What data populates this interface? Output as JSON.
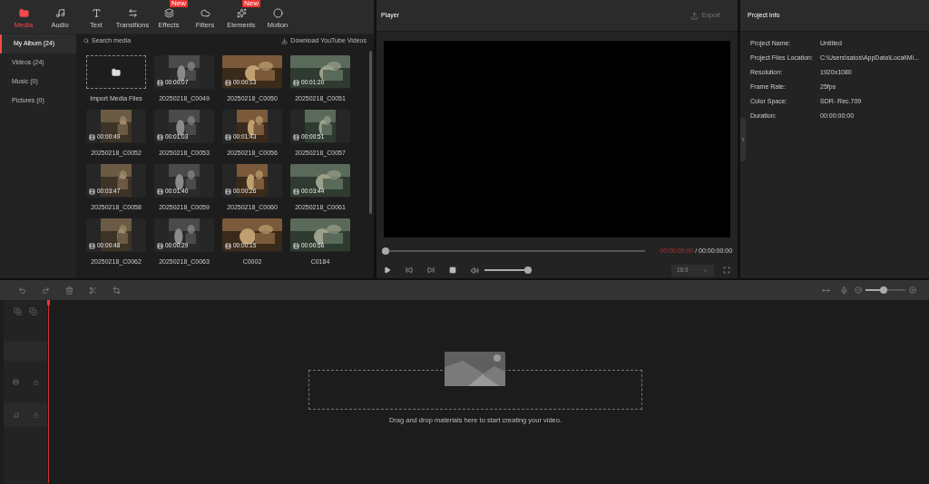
{
  "tabs": [
    {
      "label": "Media",
      "selected": true
    },
    {
      "label": "Audio",
      "selected": false
    },
    {
      "label": "Text",
      "selected": false
    },
    {
      "label": "Transitions",
      "selected": false
    },
    {
      "label": "Effects",
      "selected": false,
      "badge": "New"
    },
    {
      "label": "Filters",
      "selected": false
    },
    {
      "label": "Elements",
      "selected": false,
      "badge": "New"
    },
    {
      "label": "Motion",
      "selected": false
    }
  ],
  "sidebar": {
    "items": [
      {
        "label": "My Album (24)",
        "selected": true
      },
      {
        "label": "Videos (24)",
        "selected": false
      },
      {
        "label": "Music (0)",
        "selected": false
      },
      {
        "label": "Pictures (0)",
        "selected": false
      }
    ]
  },
  "search": {
    "placeholder": "Search media"
  },
  "download_link": "Download YouTube Videos",
  "media": [
    {
      "kind": "import",
      "name": "Import Media Files"
    },
    {
      "kind": "portrait",
      "name": "20250218_C0049",
      "duration": "00:00:07"
    },
    {
      "kind": "landscape",
      "name": "20250218_C0050",
      "duration": "00:00:13"
    },
    {
      "kind": "landscape",
      "name": "20250218_C0051",
      "duration": "00:01:20"
    },
    {
      "kind": "portrait",
      "name": "20250218_C0052",
      "duration": "00:00:49"
    },
    {
      "kind": "portrait",
      "name": "20250218_C0053",
      "duration": "00:01:03"
    },
    {
      "kind": "portrait",
      "name": "20250218_C0056",
      "duration": "00:01:43"
    },
    {
      "kind": "portrait",
      "name": "20250218_C0057",
      "duration": "00:00:51"
    },
    {
      "kind": "portrait",
      "name": "20250218_C0058",
      "duration": "00:03:47"
    },
    {
      "kind": "portrait",
      "name": "20250218_C0059",
      "duration": "00:01:40"
    },
    {
      "kind": "portrait",
      "name": "20250218_C0060",
      "duration": "00:00:26"
    },
    {
      "kind": "landscape",
      "name": "20250218_C0061",
      "duration": "00:03:44"
    },
    {
      "kind": "portrait",
      "name": "20250218_C0062",
      "duration": "00:00:48"
    },
    {
      "kind": "portrait",
      "name": "20250218_C0063",
      "duration": "00:00:29"
    },
    {
      "kind": "landscape",
      "name": "C0002",
      "duration": "00:00:15"
    },
    {
      "kind": "landscape",
      "name": "C0184",
      "duration": "00:00:56"
    }
  ],
  "player": {
    "title": "Player",
    "export": "Export",
    "current_time": "00:00:00:00",
    "total_time": "/ 00:00:00:00",
    "progress": {
      "level": 0
    },
    "volume": {
      "level": 1
    },
    "aspect": "16:9"
  },
  "project_info": {
    "title": "Project Info",
    "rows": [
      {
        "label": "Project Name:",
        "value": "Untitled"
      },
      {
        "label": "Project Files Location:",
        "value": "C:\\Users\\satos\\AppData\\Local\\Mi..."
      },
      {
        "label": "Resolution:",
        "value": "1920x1080"
      },
      {
        "label": "Frame Rate:",
        "value": "25fps"
      },
      {
        "label": "Color Space:",
        "value": "SDR- Rec.709"
      },
      {
        "label": "Duration:",
        "value": "00:00:00:00"
      }
    ]
  },
  "timeline": {
    "zoom": {
      "level": 0.45
    },
    "hint": "Drag and drop materials here to start creating your video."
  }
}
